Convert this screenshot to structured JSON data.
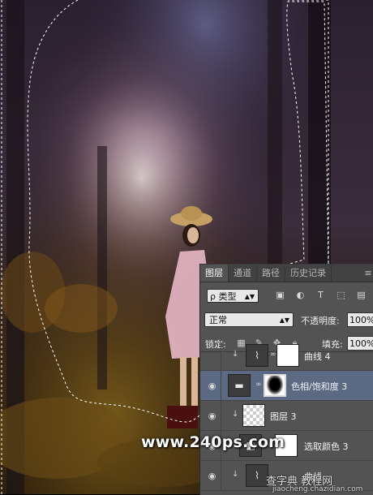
{
  "layers_panel": {
    "tabs": [
      "图层",
      "通道",
      "路径",
      "历史记录"
    ],
    "active_tab": "图层",
    "menu_icon": "panel-menu-icon",
    "filter": {
      "kind_label": "ρ 类型",
      "icons": [
        "image-filter-icon",
        "adjustment-filter-icon",
        "type-filter-icon",
        "shape-filter-icon",
        "smart-object-filter-icon"
      ]
    },
    "blend_mode": "正常",
    "opacity_label": "不透明度:",
    "opacity_value": "100%",
    "lock_label": "锁定:",
    "lock_icons": [
      "lock-transparency-icon",
      "lock-pixels-icon",
      "lock-position-icon",
      "lock-all-icon"
    ],
    "fill_label": "填充:",
    "fill_value": "100%",
    "layers": [
      {
        "name": "曲线 4",
        "visible": false,
        "type": "adjustment",
        "clipped": true
      },
      {
        "name": "色相/饱和度 3",
        "visible": true,
        "type": "adjustment",
        "selected": true
      },
      {
        "name": "图层 3",
        "visible": true,
        "type": "pixel",
        "clipped": true
      },
      {
        "name": "选取颜色 3",
        "visible": true,
        "type": "adjustment"
      },
      {
        "name": "曲线",
        "visible": true,
        "type": "adjustment",
        "clipped": true
      }
    ]
  },
  "watermarks": {
    "site": "www.240ps.com",
    "chinese": "查字典 教程网",
    "domain": "jiaocheng.chazidian.com"
  },
  "colors": {
    "panel_bg": "#535353",
    "selected_layer": "#5b6a82"
  }
}
